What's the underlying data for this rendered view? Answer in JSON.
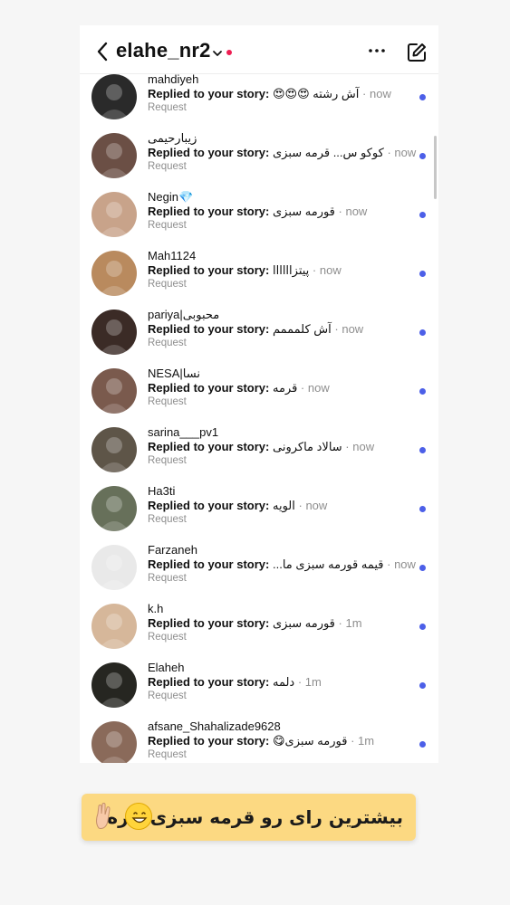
{
  "header": {
    "username": "elahe_nr2"
  },
  "conversations": [
    {
      "name": "mahdiyeh",
      "replied": "Replied to your story:",
      "message": "آش رشته 😍😍😍",
      "time": "now",
      "request": "Request",
      "avatar_color": "#2a2a2a"
    },
    {
      "name": "زیبارحیمی",
      "replied": "Replied to your story:",
      "message": "کوکو س... قرمه سبزی",
      "time": "now",
      "request": "Request",
      "avatar_color": "#6b4f45"
    },
    {
      "name": "Negin💎",
      "replied": "Replied to your story:",
      "message": "قورمه سبزی",
      "time": "now",
      "request": "Request",
      "avatar_color": "#c8a38a"
    },
    {
      "name": "Mah1124",
      "replied": "Replied to your story:",
      "message": "پیتزاااااا",
      "time": "now",
      "request": "Request",
      "avatar_color": "#b98a5e"
    },
    {
      "name": "pariya|محبوبی",
      "replied": "Replied to your story:",
      "message": "آش کلمممم",
      "time": "now",
      "request": "Request",
      "avatar_color": "#3b2b26"
    },
    {
      "name": "NESA|نسا",
      "replied": "Replied to your story:",
      "message": "قرمه",
      "time": "now",
      "request": "Request",
      "avatar_color": "#7a5a4d"
    },
    {
      "name": "sarina___pv1",
      "replied": "Replied to your story:",
      "message": "سالاد ماکرونی",
      "time": "now",
      "request": "Request",
      "avatar_color": "#5e5548"
    },
    {
      "name": "Ha3ti",
      "replied": "Replied to your story:",
      "message": "الویه",
      "time": "now",
      "request": "Request",
      "avatar_color": "#67705a"
    },
    {
      "name": "Farzaneh",
      "replied": "Replied to your story:",
      "message": "قیمه قورمه سبزی ما...",
      "time": "now",
      "request": "Request",
      "avatar_color": "#e9e9e9"
    },
    {
      "name": "k.h",
      "replied": "Replied to your story:",
      "message": "قورمه سبزی",
      "time": "1m",
      "request": "Request",
      "avatar_color": "#d6b79a"
    },
    {
      "name": "Elaheh",
      "replied": "Replied to your story:",
      "message": "دلمه",
      "time": "1m",
      "request": "Request",
      "avatar_color": "#262621"
    },
    {
      "name": "afsane_Shahalizade9628",
      "replied": "Replied to your story:",
      "message": "قورمه سبزی😋",
      "time": "1m",
      "request": "Request",
      "avatar_color": "#8a6a5a"
    }
  ],
  "banner": {
    "text": "بیشترین رای رو قرمه سبزی داره"
  },
  "colors": {
    "unread": "#4c5fe8",
    "banner_bg": "#fcd982",
    "status_dot": "#ee1d52"
  }
}
